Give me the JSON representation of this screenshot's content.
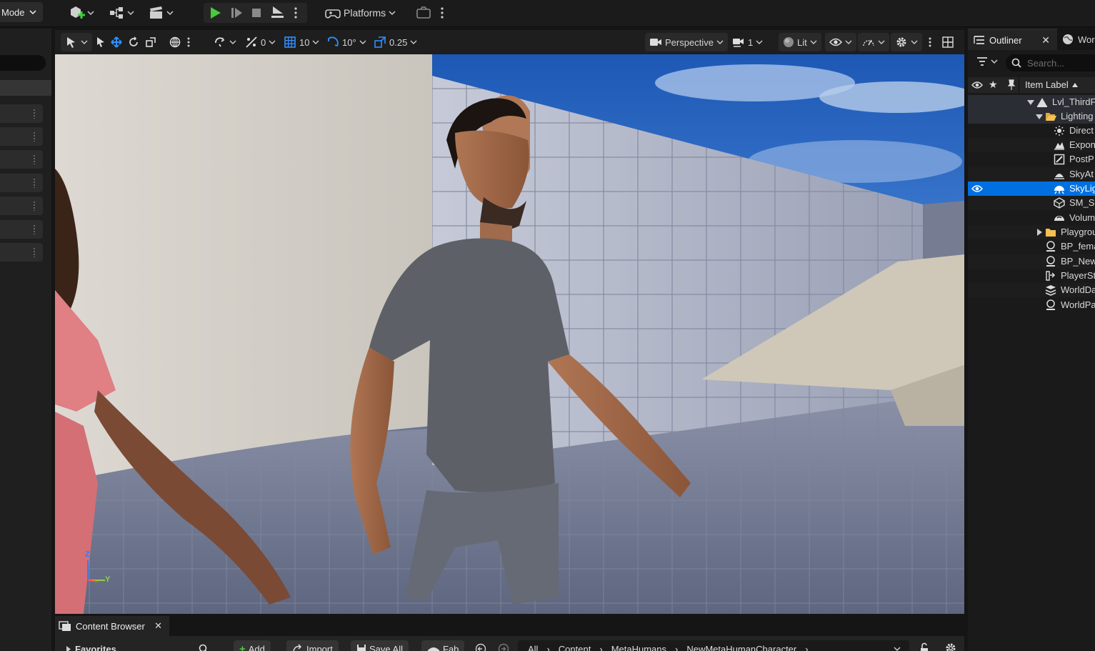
{
  "toolbar": {
    "mode_label": "Mode",
    "platforms_label": "Platforms"
  },
  "viewport_toolbar": {
    "snap_translate": "0",
    "grid_size": "10",
    "rotation_snap": "10°",
    "scale_snap": "0.25",
    "perspective_label": "Perspective",
    "camera_speed": "1",
    "view_mode_label": "Lit"
  },
  "axis_gizmo": {
    "z_label": "Z",
    "y_label": "Y"
  },
  "outliner": {
    "tab_label": "Outliner",
    "world_tab_label": "Wor",
    "search_placeholder": "Search...",
    "column_label": "Item Label",
    "items": [
      {
        "label": "Lvl_ThirdF",
        "icon": "level-icon"
      },
      {
        "label": "Lighting",
        "icon": "folder-open-icon"
      },
      {
        "label": "Direct",
        "icon": "directional-light-icon"
      },
      {
        "label": "Expon",
        "icon": "exponential-fog-icon"
      },
      {
        "label": "PostP",
        "icon": "post-process-icon"
      },
      {
        "label": "SkyAt",
        "icon": "sky-atmosphere-icon"
      },
      {
        "label": "SkyLig",
        "icon": "sky-light-icon"
      },
      {
        "label": "SM_Sl",
        "icon": "static-mesh-icon"
      },
      {
        "label": "Volum",
        "icon": "volumetric-cloud-icon"
      },
      {
        "label": "Playgrou",
        "icon": "folder-icon"
      },
      {
        "label": "BP_fema",
        "icon": "blueprint-actor-icon"
      },
      {
        "label": "BP_New",
        "icon": "blueprint-actor-icon"
      },
      {
        "label": "PlayerSt",
        "icon": "player-start-icon"
      },
      {
        "label": "WorldDa",
        "icon": "world-data-layers-icon"
      },
      {
        "label": "WorldPa",
        "icon": "world-partition-icon"
      }
    ]
  },
  "content_browser": {
    "tab_label": "Content Browser",
    "favorites_label": "Favorites",
    "add_label": "Add",
    "import_label": "Import",
    "save_all_label": "Save All",
    "fab_label": "Fab",
    "breadcrumb": [
      "All",
      "Content",
      "MetaHumans",
      "NewMetaHumanCharacter"
    ]
  },
  "colors": {
    "accent": "#0070e0",
    "play_green": "#49c93b",
    "gizmo_blue": "#2f8fff"
  }
}
